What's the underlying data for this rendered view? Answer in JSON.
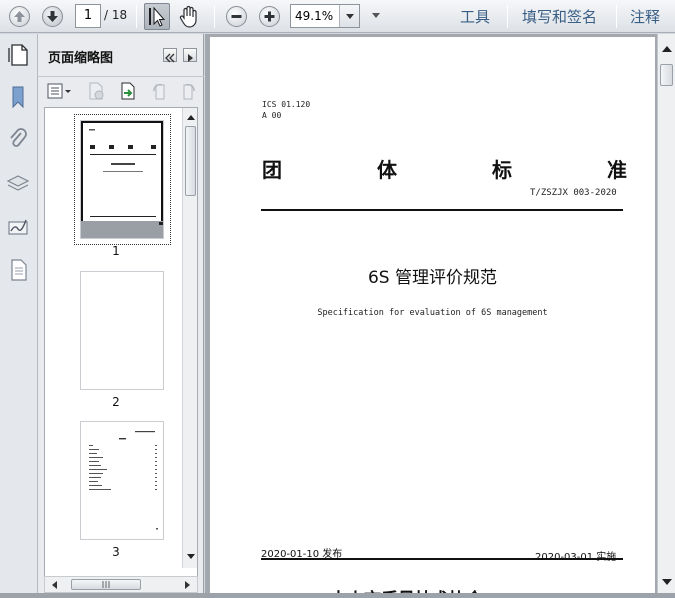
{
  "toolbar": {
    "page_current": "1",
    "page_total": "/ 18",
    "zoom": "49.1%",
    "tools_label": "工具",
    "fill_sign_label": "填写和签名",
    "comment_label": "注释"
  },
  "thumbnails_panel": {
    "title": "页面缩略图",
    "pages": [
      {
        "label": "1"
      },
      {
        "label": "2"
      },
      {
        "label": "3"
      }
    ]
  },
  "document": {
    "ics": "ICS 01.120",
    "ccs": "A 00",
    "standard_type": [
      "团",
      "体",
      "标",
      "准"
    ],
    "standard_number": "T/ZSZJX 003-2020",
    "title_cn": "6S 管理评价规范",
    "title_en": "Specification for evaluation of 6S management",
    "publish_date": "2020-01-10 发布",
    "implement_date": "2020-03-01 实施",
    "publisher": "中山市质量技术协会",
    "publisher_suffix": "发布"
  },
  "colors": {
    "toolbar_link": "#3a5f86",
    "viewer_background": "#a3a8ae"
  }
}
